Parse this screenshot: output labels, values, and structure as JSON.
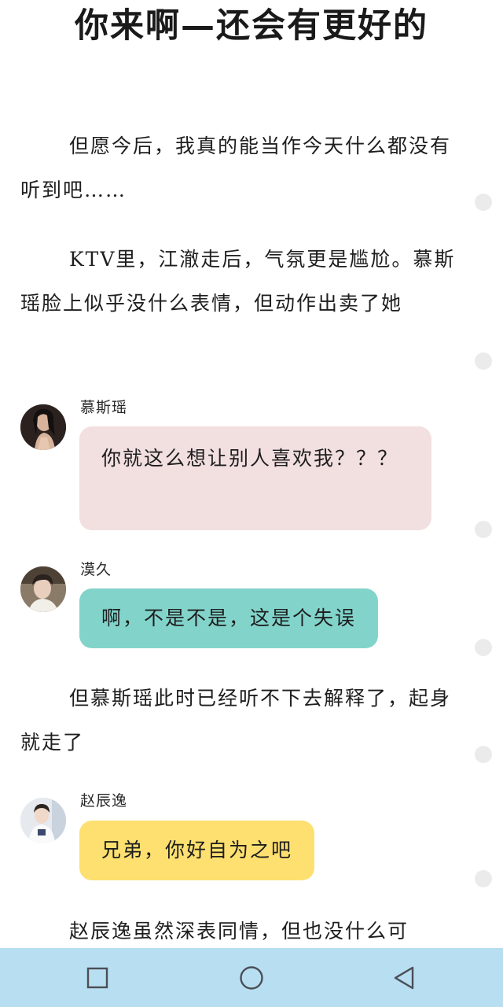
{
  "title": "你来啊—还会有更好的",
  "paragraphs": {
    "p1": "但愿今后，我真的能当作今天什么都没有听到吧……",
    "p2": "KTV里，江澈走后，气氛更是尴尬。慕斯瑶脸上似乎没什么表情，但动作出卖了她",
    "p3": "但慕斯瑶此时已经听不下去解释了，起身就走了",
    "p4": "赵辰逸虽然深表同情，但也没什么可"
  },
  "messages": [
    {
      "speaker": "慕斯瑶",
      "text": "你就这么想让别人喜欢我？？？",
      "color": "#f2dfe0",
      "avatar_icon": "avatar-girl-icon"
    },
    {
      "speaker": "漠久",
      "text": "啊，不是不是，这是个失误",
      "color": "#82d4cb",
      "avatar_icon": "avatar-boy-icon"
    },
    {
      "speaker": "赵辰逸",
      "text": "兄弟，你好自为之吧",
      "color": "#fde070",
      "avatar_icon": "avatar-boy-white-shirt-icon"
    }
  ],
  "navigation": {
    "background": "#b8def2",
    "buttons": [
      "recent-apps-icon",
      "home-icon",
      "back-icon"
    ]
  }
}
